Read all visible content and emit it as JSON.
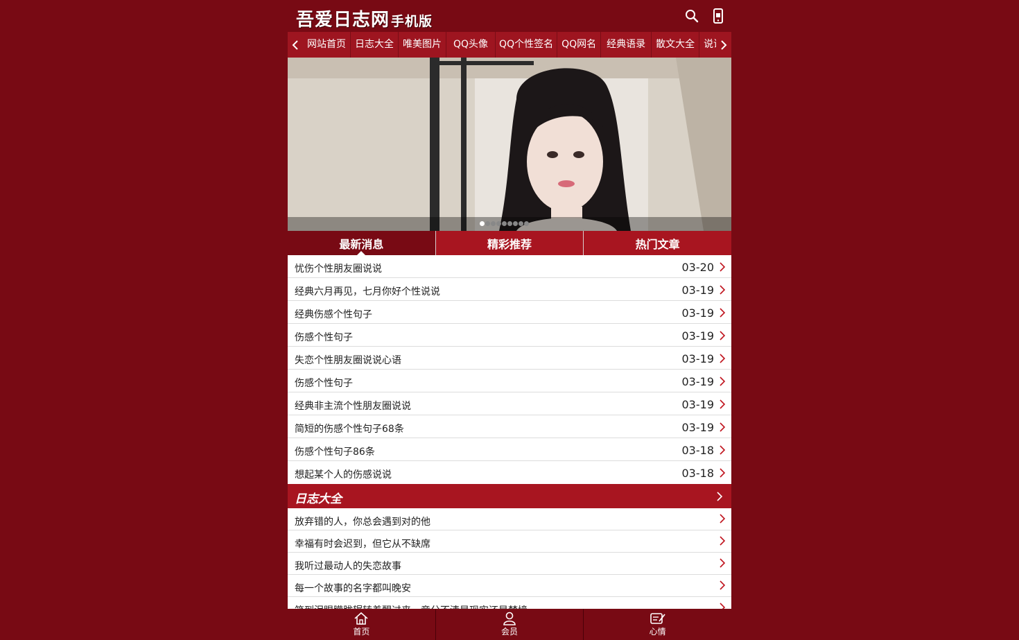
{
  "header": {
    "logo_main": "吾爱日志网",
    "logo_sub": "手机版",
    "search_icon": "search-icon",
    "mobile_icon": "mobile-icon"
  },
  "nav": {
    "items": [
      "网站首页",
      "日志大全",
      "唯美图片",
      "QQ头像",
      "QQ个性签名",
      "QQ网名",
      "经典语录",
      "散文大全",
      "说说"
    ]
  },
  "banner": {
    "slide_count": 9,
    "active_slide": 1
  },
  "tabs": [
    {
      "label": "最新消息",
      "active": true
    },
    {
      "label": "精彩推荐",
      "active": false
    },
    {
      "label": "热门文章",
      "active": false
    }
  ],
  "latest": [
    {
      "title": "忧伤个性朋友圈说说",
      "date": "03-20"
    },
    {
      "title": "经典六月再见，七月你好个性说说",
      "date": "03-19"
    },
    {
      "title": "经典伤感个性句子",
      "date": "03-19"
    },
    {
      "title": "伤感个性句子",
      "date": "03-19"
    },
    {
      "title": "失恋个性朋友圈说说心语",
      "date": "03-19"
    },
    {
      "title": "伤感个性句子",
      "date": "03-19"
    },
    {
      "title": "经典非主流个性朋友圈说说",
      "date": "03-19"
    },
    {
      "title": "简短的伤感个性句子68条",
      "date": "03-19"
    },
    {
      "title": "伤感个性句子86条",
      "date": "03-18"
    },
    {
      "title": "想起某个人的伤感说说",
      "date": "03-18"
    }
  ],
  "section": {
    "title": "日志大全"
  },
  "diary": [
    {
      "title": "放弃错的人，你总会遇到对的他"
    },
    {
      "title": "幸福有时会迟到，但它从不缺席"
    },
    {
      "title": "我听过最动人的失恋故事"
    },
    {
      "title": "每一个故事的名字都叫晚安"
    },
    {
      "title": "笑到泪眼朦胧辗转着醒过来，竟分不清是现实还是梦境"
    }
  ],
  "bottom_nav": [
    {
      "label": "首页",
      "icon": "home-icon"
    },
    {
      "label": "会员",
      "icon": "user-icon"
    },
    {
      "label": "心情",
      "icon": "edit-icon"
    }
  ],
  "colors": {
    "background": "#780a14",
    "header": "#780a14",
    "nav": "#9e1520",
    "accent": "#a81520",
    "chevron": "#c0141e"
  }
}
